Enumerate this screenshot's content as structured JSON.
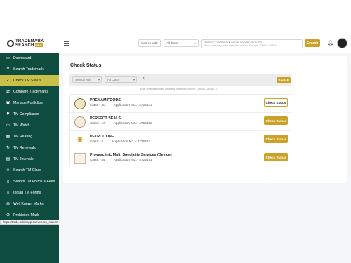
{
  "brand": {
    "line1": "TRADEMARK",
    "line2": "SEARCH",
    "badge": "PRO"
  },
  "header": {
    "search_with": "Search with",
    "class_select": "All Class",
    "search_placeholder": "Search Trademark name / Application No...",
    "search_example": "Enter comma separated application number (Example: 1234546,1234567...)",
    "search_button": "Search"
  },
  "sidebar": {
    "items": [
      {
        "label": "Dashboard",
        "icon": "monitor-icon"
      },
      {
        "label": "Search Trademark",
        "icon": "search-icon"
      },
      {
        "label": "Check TM Status",
        "icon": "check-icon",
        "active": true
      },
      {
        "label": "Compare Trademarks",
        "icon": "compare-icon"
      },
      {
        "label": "Manage Portfolios",
        "icon": "folder-icon"
      },
      {
        "label": "TM Compliance",
        "icon": "flag-icon"
      },
      {
        "label": "TM Watch",
        "icon": "monitor-icon"
      },
      {
        "label": "TM Hearing",
        "icon": "calendar-icon"
      },
      {
        "label": "TM Renewals",
        "icon": "refresh-icon"
      },
      {
        "label": "TM Journals",
        "icon": "book-icon"
      },
      {
        "label": "Search TM Class",
        "icon": "users-icon"
      },
      {
        "label": "Search TM Forms & Fees",
        "icon": "document-icon"
      },
      {
        "label": "Indian TM Forms",
        "icon": "list-icon"
      },
      {
        "label": "Well Known Marks",
        "icon": "globe-icon"
      },
      {
        "label": "Prohibited Mark",
        "icon": "ban-icon"
      }
    ],
    "status_url": "https://trade.orkiinapp.com/check_status#"
  },
  "main": {
    "title": "Check Status",
    "filter": {
      "search_with": "Search with",
      "class_select": "All Class",
      "input_value": "4|",
      "button": "Search",
      "hint": "Enter comma separated application numbers (Example: 1234546,1234567...)"
    },
    "results": [
      {
        "name": "PREMAM FOODS",
        "class": "Class:- 30",
        "app_no": "Application No.:- 4725432",
        "button": "Check Status",
        "style": "outline"
      },
      {
        "name": "PERFECT SEALS",
        "class": "Class:- 17",
        "app_no": "Application No.:- 4725482",
        "button": "Check Status",
        "style": "filled"
      },
      {
        "name": "PETROL ONE",
        "class": "Class:- 4",
        "app_no": "Application No.:- 4725487",
        "button": "Check Status",
        "style": "filled"
      },
      {
        "name": "Provasclinic Multi Speciality Services (Device)",
        "class": "Class:- 44",
        "app_no": "Application No.:- 4725451",
        "button": "Check Status",
        "style": "filled"
      }
    ]
  },
  "colors": {
    "sidebar": "#0f4c40",
    "active": "#c9c04a",
    "accent": "#c9a227"
  }
}
